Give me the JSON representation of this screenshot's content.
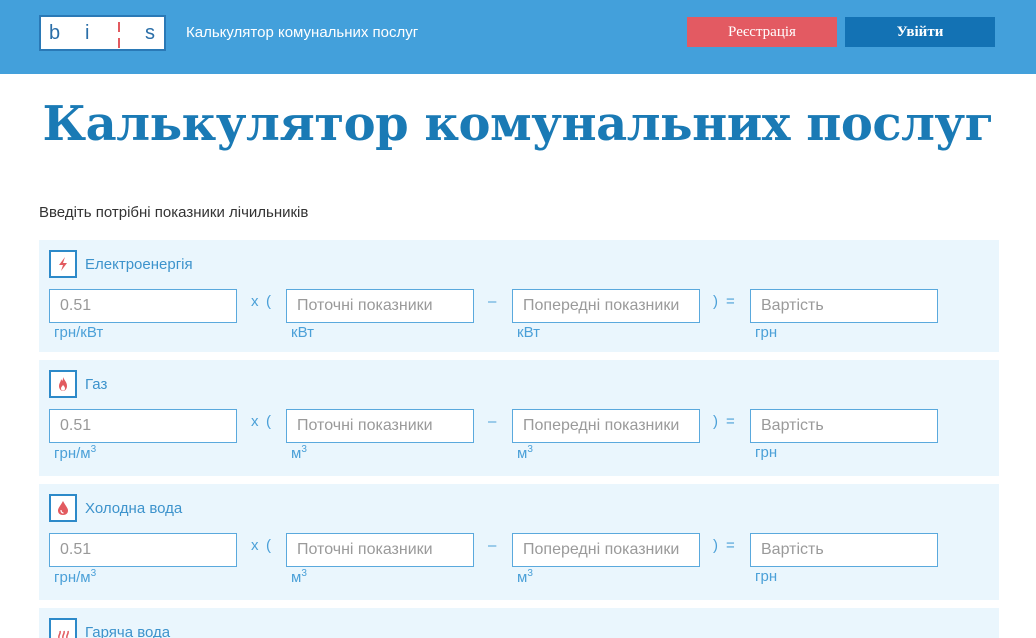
{
  "header": {
    "logo_letters": [
      "b",
      "i",
      "s"
    ],
    "title": "Калькулятор комунальних послуг",
    "register_label": "Реєстрація",
    "logout_label": "Увійти"
  },
  "page_title": "Калькулятор комунальних послуг",
  "intro": "Введіть потрібні показники лічильників",
  "operators": {
    "times": "x",
    "open": "(",
    "minus": "–",
    "close": ")",
    "equals": "="
  },
  "rows": [
    {
      "label": "Електроенергія",
      "icon": "lightning-icon",
      "rate_value": "0.51",
      "rate_unit": "грн/кВт",
      "current_placeholder": "Поточні показники",
      "current_unit": "кВт",
      "previous_placeholder": "Попередні показники",
      "previous_unit": "кВт",
      "cost_placeholder": "Вартість",
      "cost_unit": "грн"
    },
    {
      "label": "Газ",
      "icon": "flame-icon",
      "rate_value": "0.51",
      "rate_unit": "грн/м",
      "current_placeholder": "Поточні показники",
      "current_unit": "м",
      "previous_placeholder": "Попередні показники",
      "previous_unit": "м",
      "cost_placeholder": "Вартість",
      "cost_unit": "грн",
      "exponent": "3"
    },
    {
      "label": "Холодна вода",
      "icon": "water-drop-icon",
      "rate_value": "0.51",
      "rate_unit": "грн/м",
      "current_placeholder": "Поточні показники",
      "current_unit": "м",
      "previous_placeholder": "Попередні показники",
      "previous_unit": "м",
      "cost_placeholder": "Вартість",
      "cost_unit": "грн",
      "exponent": "3"
    },
    {
      "label": "Гаряча вода",
      "icon": "hot-water-icon"
    }
  ],
  "colors": {
    "header_bg": "#43a0db",
    "title": "#1a7ab5",
    "register": "#e35a62",
    "logout": "#1372b4",
    "card_bg": "#eaf6fd",
    "icon_red": "#e25a5f"
  }
}
